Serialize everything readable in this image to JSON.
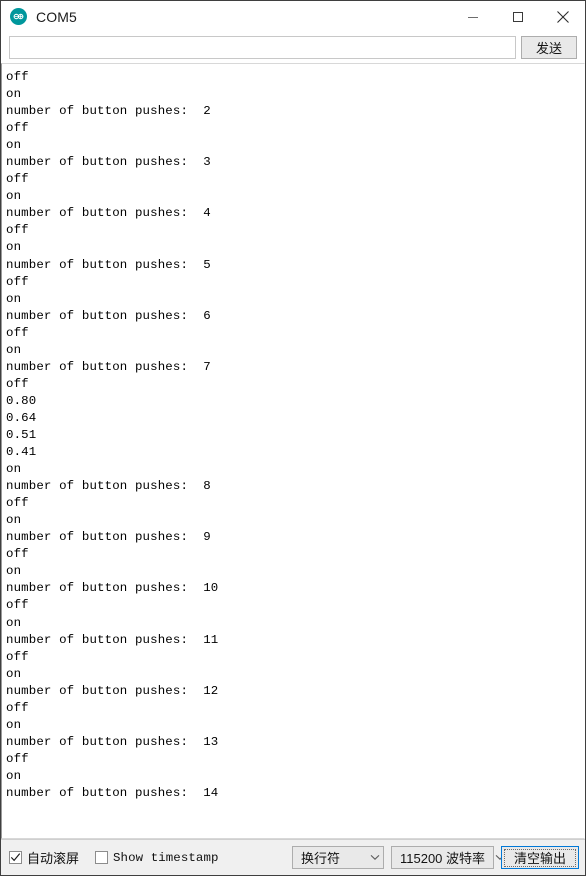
{
  "window": {
    "title": "COM5",
    "app_icon": "arduino-infinity-icon",
    "controls": {
      "minimize": "minimize-icon",
      "maximize": "maximize-icon",
      "close": "close-icon"
    }
  },
  "send_row": {
    "input_value": "",
    "input_placeholder": "",
    "send_label": "发送"
  },
  "console": {
    "text": "off\non\nnumber of button pushes:  2\noff\non\nnumber of button pushes:  3\noff\non\nnumber of button pushes:  4\noff\non\nnumber of button pushes:  5\noff\non\nnumber of button pushes:  6\noff\non\nnumber of button pushes:  7\noff\n0.80\n0.64\n0.51\n0.41\non\nnumber of button pushes:  8\noff\non\nnumber of button pushes:  9\noff\non\nnumber of button pushes:  10\noff\non\nnumber of button pushes:  11\noff\non\nnumber of button pushes:  12\noff\non\nnumber of button pushes:  13\noff\non\nnumber of button pushes:  14\n",
    "lines": [
      "off",
      "on",
      "number of button pushes:  2",
      "off",
      "on",
      "number of button pushes:  3",
      "off",
      "on",
      "number of button pushes:  4",
      "off",
      "on",
      "number of button pushes:  5",
      "off",
      "on",
      "number of button pushes:  6",
      "off",
      "on",
      "number of button pushes:  7",
      "off",
      "0.80",
      "0.64",
      "0.51",
      "0.41",
      "on",
      "number of button pushes:  8",
      "off",
      "on",
      "number of button pushes:  9",
      "off",
      "on",
      "number of button pushes:  10",
      "off",
      "on",
      "number of button pushes:  11",
      "off",
      "on",
      "number of button pushes:  12",
      "off",
      "on",
      "number of button pushes:  13",
      "off",
      "on",
      "number of button pushes:  14"
    ]
  },
  "status_bar": {
    "autoscroll": {
      "label": "自动滚屏",
      "checked": true,
      "icon": "checkmark-icon"
    },
    "timestamp": {
      "label": "Show timestamp",
      "checked": false
    },
    "line_ending": {
      "selected": "换行符",
      "arrow": "chevron-down-icon"
    },
    "baud_rate": {
      "selected": "115200 波特率",
      "arrow": "chevron-down-icon"
    },
    "clear_button": {
      "label": "清空输出",
      "focused": true
    }
  },
  "colors": {
    "accent": "#00979c",
    "focus_border": "#0078d7",
    "status_bg": "#f0f0f0",
    "control_bg": "#e9e9e9",
    "text": "#000000"
  }
}
